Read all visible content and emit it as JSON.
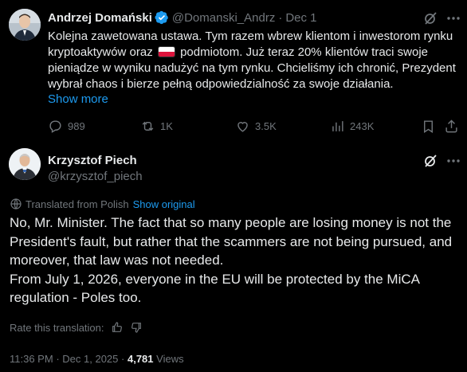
{
  "quoted_post": {
    "author_name": "Andrzej Domański",
    "handle": "@Domanski_Andrz",
    "separator": "·",
    "date": "Dec 1",
    "text_part1": "Kolejna zawetowana ustawa. Tym razem wbrew klientom i inwestorom rynku kryptoaktywów oraz",
    "text_part2": "podmiotom. Już teraz 20% klientów traci swoje pieniądze w wyniku nadużyć na tym rynku. Chcieliśmy ich chronić, Prezydent wybrał chaos i bierze pełną odpowiedzialność za swoje działania.",
    "show_more": "Show more",
    "flag_icon": "poland-flag-emoji",
    "stats": {
      "replies": "989",
      "reposts": "1K",
      "likes": "3.5K",
      "views": "243K"
    }
  },
  "main_post": {
    "author_name": "Krzysztof Piech",
    "handle": "@krzysztof_piech",
    "translated_label": "Translated from Polish",
    "show_original": "Show original",
    "paragraph1": "No, Mr. Minister. The fact that so many people are losing money is not the President's fault, but rather that the scammers are not being pursued, and moreover, that law was not needed.",
    "paragraph2": "From July 1, 2026, everyone in the EU will be protected by the MiCA regulation - Poles too.",
    "rate_label": "Rate this translation:",
    "time": "11:36 PM",
    "separator": "·",
    "date": "Dec 1, 2025",
    "views_count": "4,781",
    "views_label": "Views"
  },
  "colors": {
    "background": "#000000",
    "text": "#e7e9ea",
    "secondary": "#71767b",
    "link": "#1d9bf0",
    "verified": "#1d9bf0"
  }
}
